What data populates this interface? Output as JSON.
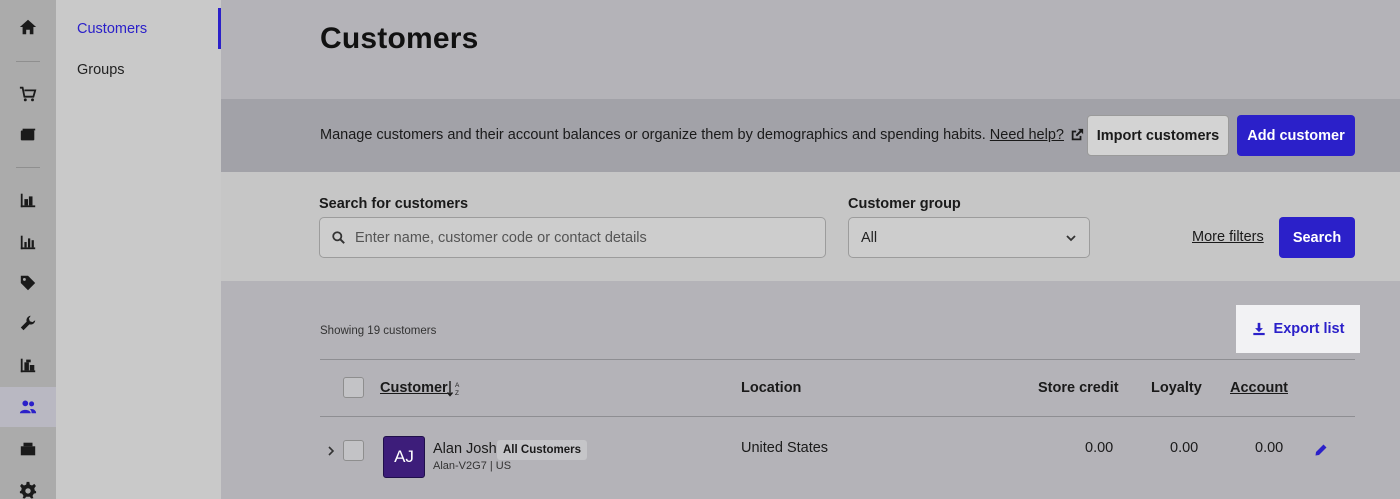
{
  "rail": {
    "icons": [
      "home-icon",
      "cart-icon",
      "register-icon",
      "inventory-icon",
      "reports-icon",
      "tag-icon",
      "wrench-icon",
      "warehouse-icon",
      "customers-icon",
      "cash-icon",
      "gear-icon"
    ],
    "active": "customers-icon"
  },
  "subnav": {
    "items": [
      {
        "label": "Customers",
        "active": true
      },
      {
        "label": "Groups",
        "active": false
      }
    ]
  },
  "header": {
    "title": "Customers"
  },
  "band": {
    "description": "Manage customers and their account balances or organize them by demographics and spending habits.",
    "help_link": "Need help?",
    "import_label": "Import customers",
    "add_label": "Add customer"
  },
  "search": {
    "search_label": "Search for customers",
    "search_placeholder": "Enter name, customer code or contact details",
    "group_label": "Customer group",
    "group_value": "All",
    "more_filters": "More filters",
    "search_button": "Search"
  },
  "list": {
    "showing": "Showing 19 customers",
    "export_label": "Export list",
    "columns": {
      "customer": "Customer",
      "location": "Location",
      "store_credit": "Store credit",
      "loyalty": "Loyalty",
      "account": "Account"
    },
    "rows": [
      {
        "initials": "AJ",
        "name": "Alan Josh",
        "badge": "All Customers",
        "code": "Alan-V2G7 | US",
        "location": "United States",
        "store_credit": "0.00",
        "loyalty": "0.00",
        "account": "0.00"
      }
    ]
  },
  "colors": {
    "accent": "#2b20c9",
    "avatar": "#3d1d7a"
  }
}
